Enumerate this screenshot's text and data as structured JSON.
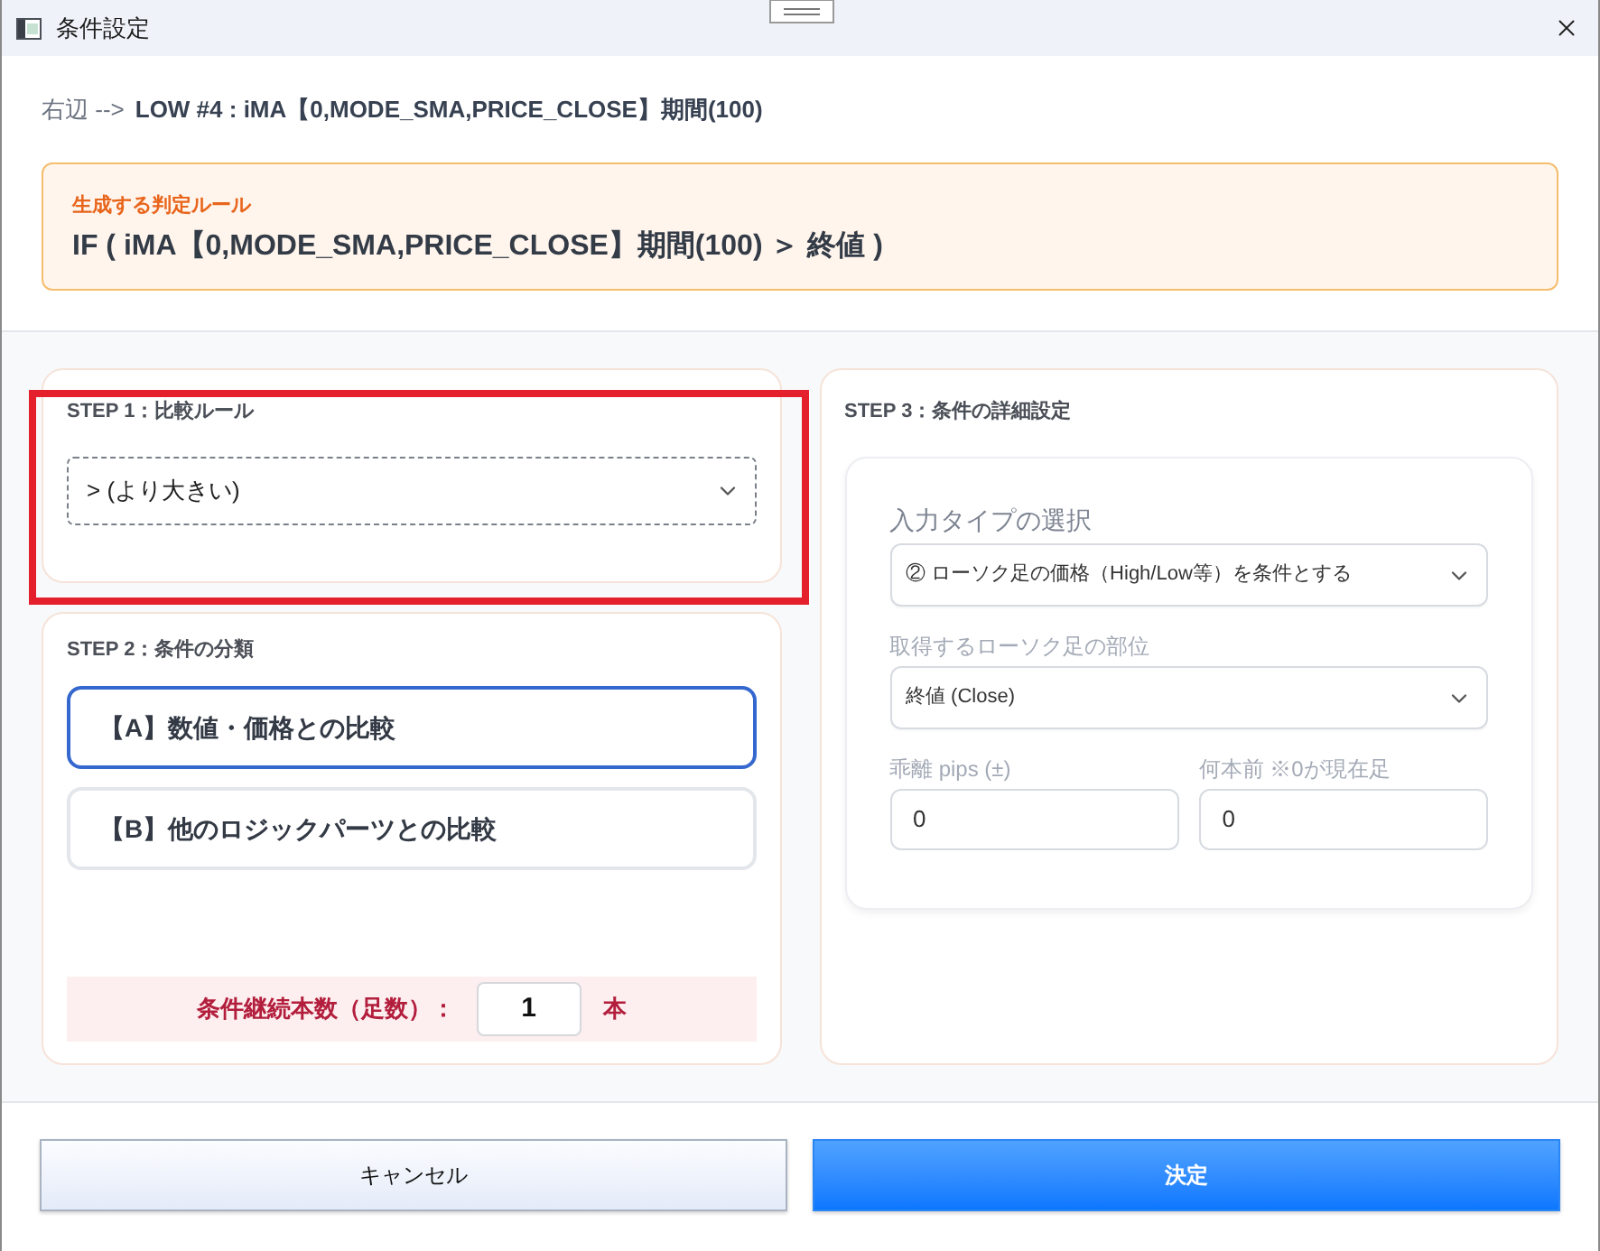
{
  "window": {
    "title": "条件設定"
  },
  "header": {
    "source_label": "右辺 -->",
    "source_value": "LOW #4 : iMA【0,MODE_SMA,PRICE_CLOSE】期間(100)"
  },
  "rule_box": {
    "label": "生成する判定ルール",
    "rule": "IF ( iMA【0,MODE_SMA,PRICE_CLOSE】期間(100) ＞ 終値 )"
  },
  "step1": {
    "title": "STEP 1：比較ルール",
    "highlighted": true,
    "select": {
      "value": "> (より大きい)",
      "focused": true
    }
  },
  "step2": {
    "title": "STEP 2：条件の分類",
    "options": [
      {
        "label": "【A】数値・価格との比較",
        "selected": true
      },
      {
        "label": "【B】他のロジックパーツとの比較",
        "selected": false
      }
    ],
    "count": {
      "label": "条件継続本数（足数）：",
      "value": "1",
      "unit": "本"
    }
  },
  "step3": {
    "title": "STEP 3：条件の詳細設定",
    "fields": [
      {
        "kind": "select",
        "label": "入力タイプの選択",
        "value": "② ローソク足の価格（High/Low等）を条件とする"
      },
      {
        "kind": "select",
        "label": "取得するローソク足の部位",
        "value": "終値 (Close)"
      },
      {
        "kind": "input",
        "label": "乖離 pips (±)",
        "value": "0"
      },
      {
        "kind": "input",
        "label": "何本前 ※0が現在足",
        "value": "0"
      }
    ]
  },
  "buttons": [
    {
      "label": "キャンセル",
      "kind": "secondary"
    },
    {
      "label": "決定",
      "kind": "primary"
    }
  ]
}
